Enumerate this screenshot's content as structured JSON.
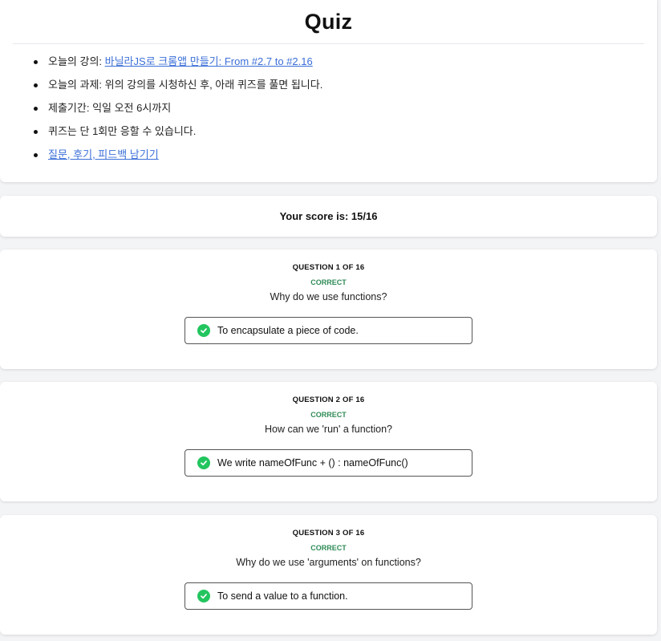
{
  "header": {
    "title": "Quiz",
    "items": [
      {
        "label": "오늘의 강의: ",
        "link": "바닐라JS로 크롬앱 만들기: From #2.7 to #2.16"
      },
      {
        "label": "오늘의 과제: 위의 강의를 시청하신 후, 아래 퀴즈를 풀면 됩니다."
      },
      {
        "label": "제출기간: 익일 오전 6시까지"
      },
      {
        "label": "퀴즈는 단 1회만 응할 수 있습니다."
      },
      {
        "link": "질문, 후기, 피드백 남기기"
      }
    ]
  },
  "score": {
    "text": "Your score is: 15/16"
  },
  "questions": [
    {
      "number": "QUESTION 1 OF 16",
      "status": "CORRECT",
      "question": "Why do we use functions?",
      "answer": "To encapsulate a piece of code."
    },
    {
      "number": "QUESTION 2 OF 16",
      "status": "CORRECT",
      "question": "How can we 'run' a function?",
      "answer": "We write nameOfFunc + () : nameOfFunc()"
    },
    {
      "number": "QUESTION 3 OF 16",
      "status": "CORRECT",
      "question": "Why do we use 'arguments' on functions?",
      "answer": "To send a value to a function."
    }
  ],
  "colors": {
    "correct": "#2e8b57",
    "check": "#22c55e",
    "link": "#3b6fd8"
  },
  "icons": {
    "answer_status": "check-circle-icon"
  }
}
